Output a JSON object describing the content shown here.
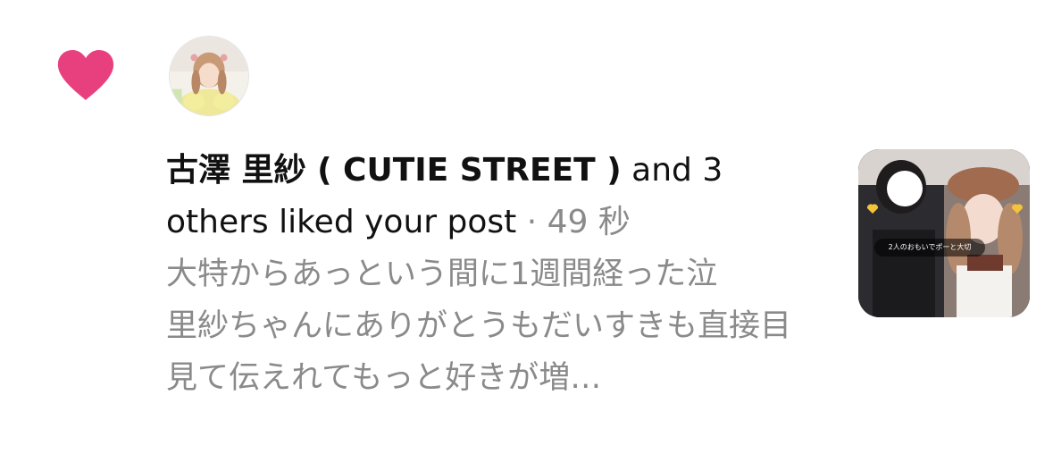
{
  "notification": {
    "type": "like",
    "icon": "heart-icon",
    "heart_color": "#E8407F",
    "username": "古澤 里紗 ( CUTIE STREET )",
    "action_text": " and 3 others liked your post",
    "separator": " · ",
    "time": "49 秒",
    "preview_text": "大特からあっという間に1週間経った泣\n里紗ちゃんにありがとうもだいすきも直接目見て伝えれてもっと好きが増…",
    "post_thumbnail": {
      "caption": "2人のおもいでポーと大切"
    }
  }
}
